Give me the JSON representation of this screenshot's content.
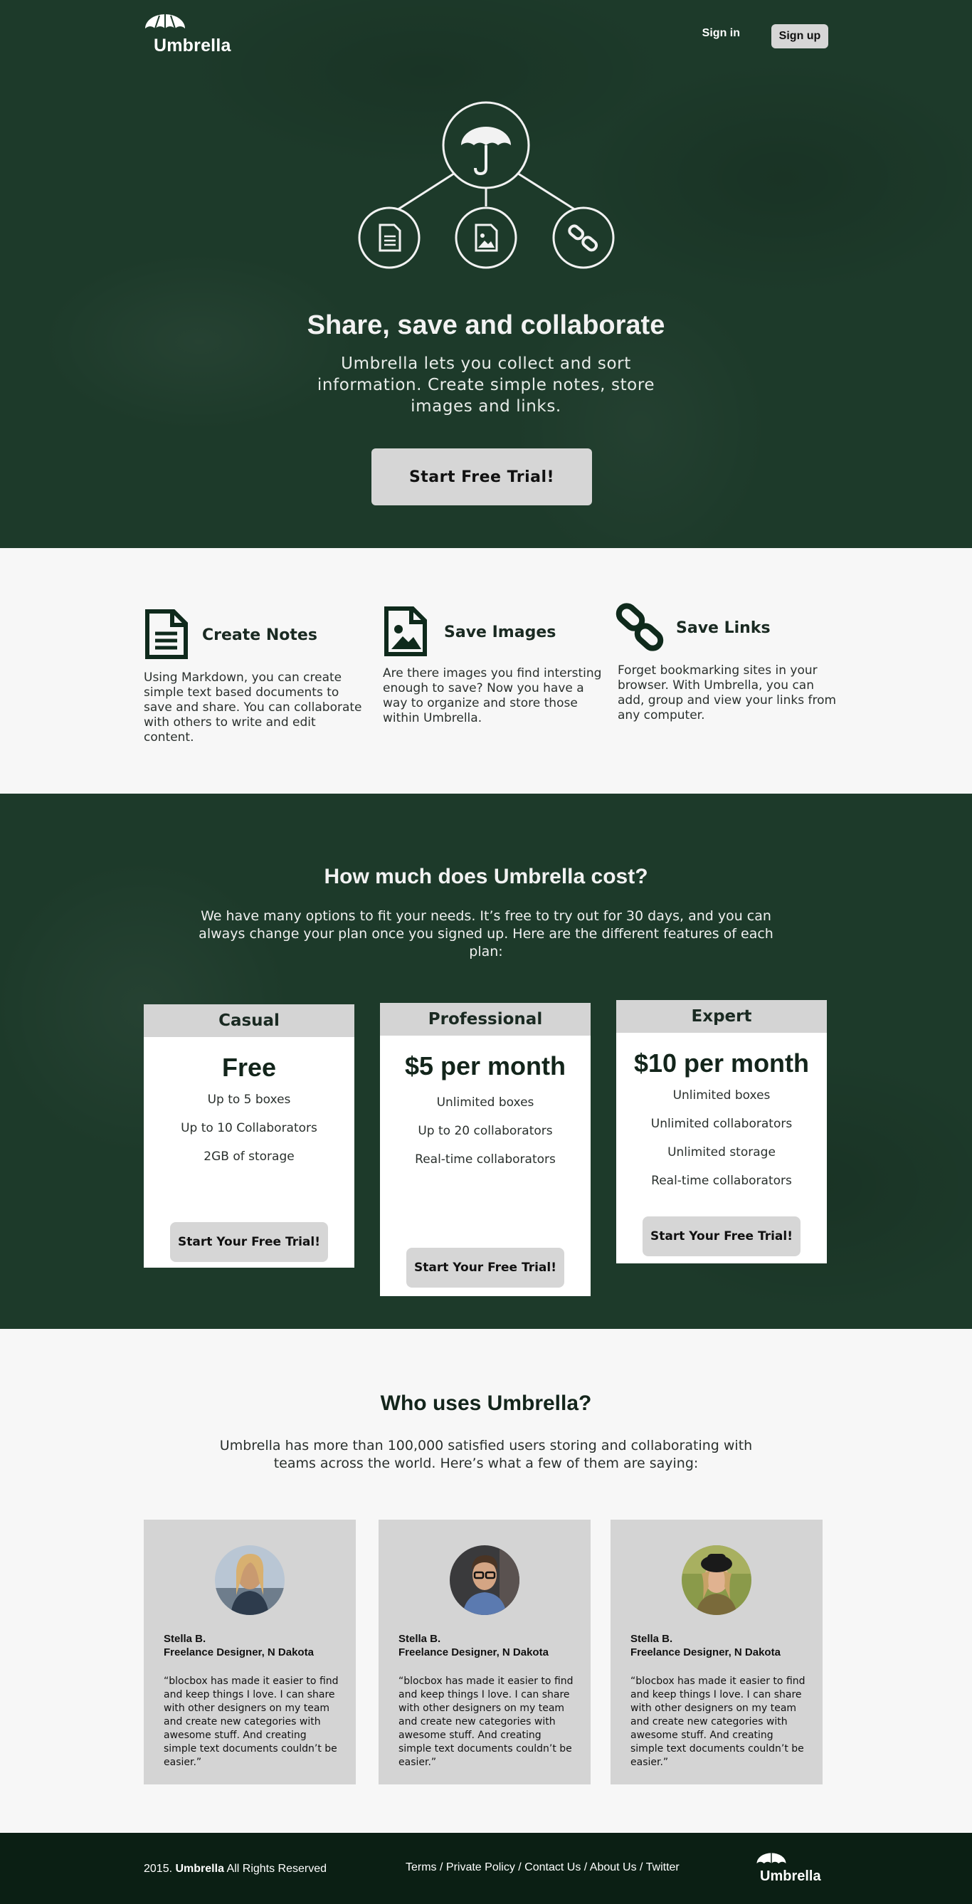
{
  "nav": {
    "logo_text": "Umbrella",
    "signin_label": "Sign in",
    "signup_label": "Sign up"
  },
  "hero": {
    "title": "Share, save and collaborate",
    "subtitle": "Umbrella lets you collect and sort information. Create simple notes, store images and links.",
    "cta_label": "Start Free Trial!",
    "icons": [
      "umbrella-icon",
      "document-icon",
      "image-icon",
      "link-icon"
    ]
  },
  "features": [
    {
      "title": "Create Notes",
      "icon": "document-icon",
      "text": "Using Markdown, you can create simple text based documents to save and share. You can collaborate with others to write and edit content."
    },
    {
      "title": "Save Images",
      "icon": "image-icon",
      "text": "Are there images you find intersting enough to save? Now you have a way to organize and store those within Umbrella."
    },
    {
      "title": "Save Links",
      "icon": "link-icon",
      "text": "Forget bookmarking sites in your browser. With Umbrella, you can add, group and view your links from any computer."
    }
  ],
  "pricing": {
    "title": "How much does Umbrella cost?",
    "subtitle": "We have many options to fit your needs. It’s free to try out for 30 days, and you can always change your plan once you signed up. Here are the different features of each plan:",
    "plans": [
      {
        "name": "Casual",
        "price": "Free",
        "features": [
          "Up to 5 boxes",
          "Up to 10 Collaborators",
          "2GB of storage"
        ],
        "cta": "Start Your Free Trial!"
      },
      {
        "name": "Professional",
        "price": "$5 per month",
        "features": [
          "Unlimited boxes",
          "Up to 20 collaborators",
          "Real-time collaborators"
        ],
        "cta": "Start Your Free Trial!"
      },
      {
        "name": "Expert",
        "price": "$10 per month",
        "features": [
          "Unlimited boxes",
          "Unlimited collaborators",
          "Unlimited storage",
          "Real-time collaborators"
        ],
        "cta": "Start Your Free Trial!"
      }
    ]
  },
  "testimonials": {
    "title": "Who uses Umbrella?",
    "subtitle": "Umbrella has more than 100,000 satisfied users storing and collaborating with teams across the world. Here’s what a few of them are saying:",
    "items": [
      {
        "name": "Stella B.",
        "role": "Freelance Designer, N Dakota",
        "quote": "“blocbox has made it easier to find and keep things I love. I can share with other designers on my team and create new categories with awesome stuff. And creating simple text documents couldn’t be easier.”"
      },
      {
        "name": "Stella B.",
        "role": "Freelance Designer, N Dakota",
        "quote": "“blocbox has made it easier to find and keep things I love. I can share with other designers on my team and create new categories with awesome stuff. And creating simple text documents couldn’t be easier.”"
      },
      {
        "name": "Stella B.",
        "role": "Freelance Designer, N Dakota",
        "quote": "“blocbox has made it easier to find and keep things I love. I can share with other designers on my team and create new categories with awesome stuff. And creating simple text documents couldn’t be easier.”"
      }
    ]
  },
  "footer": {
    "year": "2015.",
    "brand": "Umbrella",
    "rights": "All Rights Reserved",
    "links": [
      "Terms",
      "Private Policy",
      "Contact Us",
      "About Us",
      "Twitter"
    ],
    "logo_text": "Umbrella"
  },
  "colors": {
    "dark_green": "#1d3a2a",
    "footer_green": "#0b1f14",
    "light_gray": "#d6d6d6",
    "background": "#f7f7f7"
  }
}
